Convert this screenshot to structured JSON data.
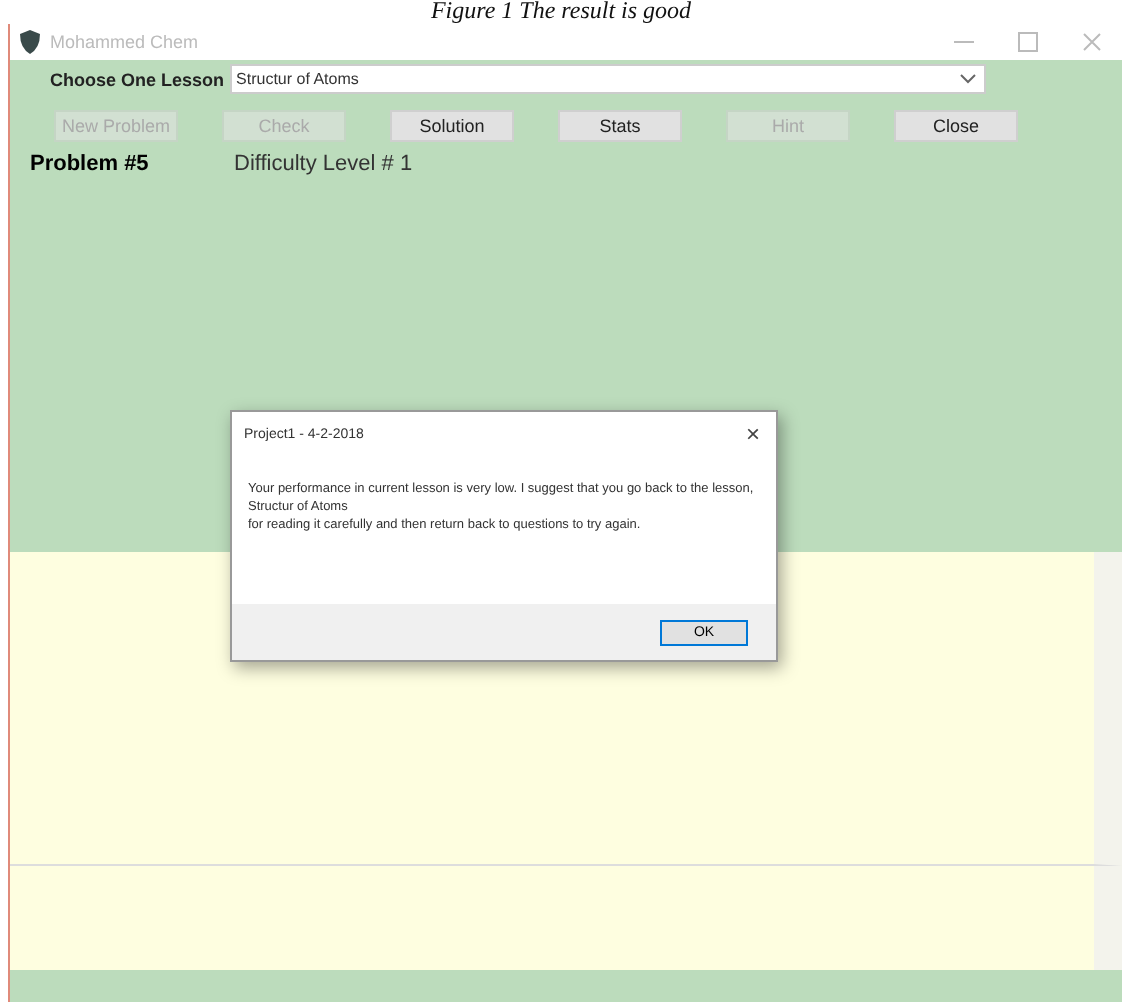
{
  "caption": "Figure 1 The result is good",
  "window": {
    "title": "Mohammed Chem"
  },
  "lesson": {
    "label": "Choose One Lesson",
    "value": "Structur of Atoms"
  },
  "buttons": [
    {
      "label": "New Problem",
      "disabled": true
    },
    {
      "label": "Check",
      "disabled": true
    },
    {
      "label": "Solution",
      "disabled": false
    },
    {
      "label": "Stats",
      "disabled": false
    },
    {
      "label": "Hint",
      "disabled": true
    },
    {
      "label": "Close",
      "disabled": false
    }
  ],
  "problem": {
    "number": "Problem #5",
    "difficulty": "Difficulty Level # 1"
  },
  "dialog": {
    "title": "Project1 - 4-2-2018",
    "close": "×",
    "message": "Your performance in current lesson is very low. I suggest that you go back to the lesson, Structur of Atoms\n for reading it carefully and then return back to questions to try again.",
    "button": "OK"
  }
}
